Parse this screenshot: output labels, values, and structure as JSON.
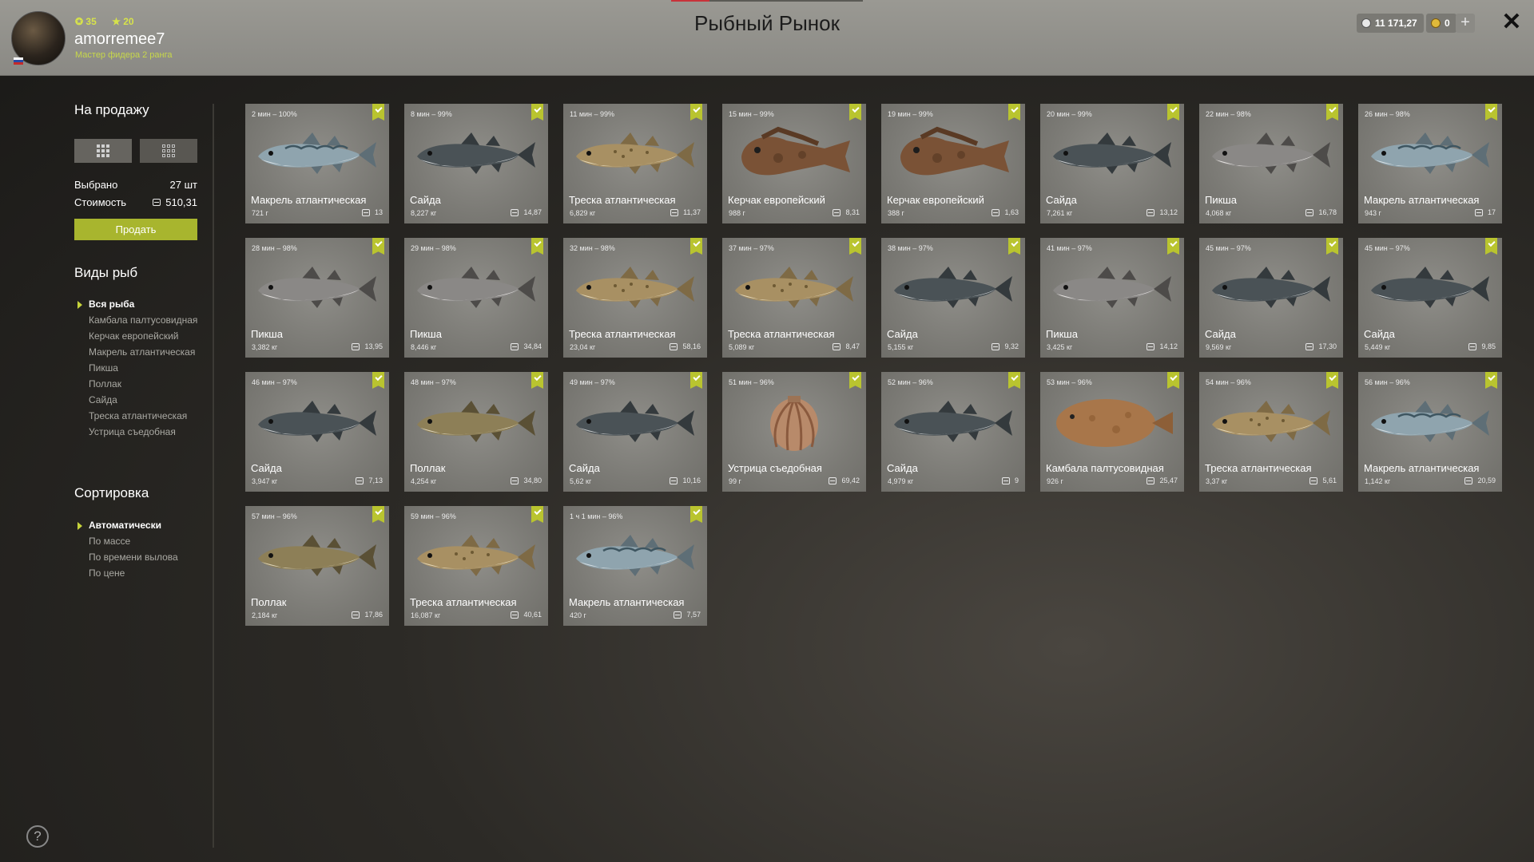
{
  "header": {
    "title": "Рыбный Рынок",
    "username": "amorremee7",
    "level": "35",
    "stars": "20",
    "rank": "Мастер фидера 2 ранга",
    "silver": "11 171,27",
    "gold": "0",
    "plus_label": "+",
    "close_label": "✕"
  },
  "sidebar": {
    "sale_heading": "На продажу",
    "selected_label": "Выбрано",
    "selected_value": "27 шт",
    "cost_label": "Стоимость",
    "cost_value": "510,31",
    "sell_button": "Продать",
    "species_heading": "Виды рыб",
    "species": [
      "Вся рыба",
      "Камбала палтусовидная",
      "Керчак европейский",
      "Макрель атлантическая",
      "Пикша",
      "Поллак",
      "Сайда",
      "Треска атлантическая",
      "Устрица съедобная"
    ],
    "species_active": 0,
    "sort_heading": "Сортировка",
    "sort_options": [
      "Автоматически",
      "По массе",
      "По времени вылова",
      "По цене"
    ],
    "sort_active": 0,
    "help_label": "?"
  },
  "fish": [
    {
      "meta": "2 мин – 100%",
      "name": "Макрель атлантическая",
      "weight": "721 г",
      "price": "13",
      "kind": "mackerel"
    },
    {
      "meta": "8 мин – 99%",
      "name": "Сайда",
      "weight": "8,227 кг",
      "price": "14,87",
      "kind": "saithe"
    },
    {
      "meta": "11 мин – 99%",
      "name": "Треска атлантическая",
      "weight": "6,829 кг",
      "price": "11,37",
      "kind": "cod"
    },
    {
      "meta": "15 мин – 99%",
      "name": "Керчак европейский",
      "weight": "988 г",
      "price": "8,31",
      "kind": "sculpin"
    },
    {
      "meta": "19 мин – 99%",
      "name": "Керчак европейский",
      "weight": "388 г",
      "price": "1,63",
      "kind": "sculpin"
    },
    {
      "meta": "20 мин – 99%",
      "name": "Сайда",
      "weight": "7,261 кг",
      "price": "13,12",
      "kind": "saithe"
    },
    {
      "meta": "22 мин – 98%",
      "name": "Пикша",
      "weight": "4,068 кг",
      "price": "16,78",
      "kind": "haddock"
    },
    {
      "meta": "26 мин – 98%",
      "name": "Макрель атлантическая",
      "weight": "943 г",
      "price": "17",
      "kind": "mackerel"
    },
    {
      "meta": "28 мин – 98%",
      "name": "Пикша",
      "weight": "3,382 кг",
      "price": "13,95",
      "kind": "haddock"
    },
    {
      "meta": "29 мин – 98%",
      "name": "Пикша",
      "weight": "8,446 кг",
      "price": "34,84",
      "kind": "haddock"
    },
    {
      "meta": "32 мин – 98%",
      "name": "Треска атлантическая",
      "weight": "23,04 кг",
      "price": "58,16",
      "kind": "cod"
    },
    {
      "meta": "37 мин – 97%",
      "name": "Треска атлантическая",
      "weight": "5,089 кг",
      "price": "8,47",
      "kind": "cod"
    },
    {
      "meta": "38 мин – 97%",
      "name": "Сайда",
      "weight": "5,155 кг",
      "price": "9,32",
      "kind": "saithe"
    },
    {
      "meta": "41 мин – 97%",
      "name": "Пикша",
      "weight": "3,425 кг",
      "price": "14,12",
      "kind": "haddock"
    },
    {
      "meta": "45 мин – 97%",
      "name": "Сайда",
      "weight": "9,569 кг",
      "price": "17,30",
      "kind": "saithe"
    },
    {
      "meta": "45 мин – 97%",
      "name": "Сайда",
      "weight": "5,449 кг",
      "price": "9,85",
      "kind": "saithe"
    },
    {
      "meta": "46 мин – 97%",
      "name": "Сайда",
      "weight": "3,947 кг",
      "price": "7,13",
      "kind": "saithe"
    },
    {
      "meta": "48 мин – 97%",
      "name": "Поллак",
      "weight": "4,254 кг",
      "price": "34,80",
      "kind": "pollack"
    },
    {
      "meta": "49 мин – 97%",
      "name": "Сайда",
      "weight": "5,62 кг",
      "price": "10,16",
      "kind": "saithe"
    },
    {
      "meta": "51 мин – 96%",
      "name": "Устрица съедобная",
      "weight": "99 г",
      "price": "69,42",
      "kind": "oyster"
    },
    {
      "meta": "52 мин – 96%",
      "name": "Сайда",
      "weight": "4,979 кг",
      "price": "9",
      "kind": "saithe"
    },
    {
      "meta": "53 мин – 96%",
      "name": "Камбала палтусовидная",
      "weight": "926 г",
      "price": "25,47",
      "kind": "flounder"
    },
    {
      "meta": "54 мин – 96%",
      "name": "Треска атлантическая",
      "weight": "3,37 кг",
      "price": "5,61",
      "kind": "cod"
    },
    {
      "meta": "56 мин – 96%",
      "name": "Макрель атлантическая",
      "weight": "1,142 кг",
      "price": "20,59",
      "kind": "mackerel"
    },
    {
      "meta": "57 мин – 96%",
      "name": "Поллак",
      "weight": "2,184 кг",
      "price": "17,86",
      "kind": "pollack"
    },
    {
      "meta": "59 мин – 96%",
      "name": "Треска атлантическая",
      "weight": "16,087 кг",
      "price": "40,61",
      "kind": "cod"
    },
    {
      "meta": "1 ч 1 мин – 96%",
      "name": "Макрель атлантическая",
      "weight": "420 г",
      "price": "7,57",
      "kind": "mackerel"
    }
  ],
  "colors": {
    "accent": "#b9c42f",
    "sell_button": "#a8b52e",
    "header_bg": "#9a9993",
    "card_bg": "#7e7d78"
  }
}
